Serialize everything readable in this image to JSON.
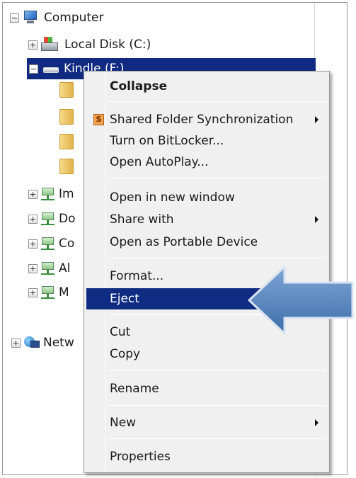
{
  "tree": {
    "computer": "Computer",
    "local_disk": "Local Disk (C:)",
    "kindle": "Kindle (F:)",
    "net_drives": [
      "Im",
      "Do",
      "Co",
      "Al",
      "M"
    ],
    "network": "Netw"
  },
  "menu": {
    "collapse": "Collapse",
    "shared_folder_sync": "Shared Folder Synchronization",
    "shared_folder_sync_icon_letter": "S",
    "bitlocker": "Turn on BitLocker...",
    "autoplay": "Open AutoPlay...",
    "open_new_window": "Open in new window",
    "share_with": "Share with",
    "portable_device": "Open as Portable Device",
    "format": "Format...",
    "eject": "Eject",
    "cut": "Cut",
    "copy": "Copy",
    "rename": "Rename",
    "new": "New",
    "properties": "Properties"
  },
  "colors": {
    "selection": "#0f2a80",
    "pointer_arrow": "#4f81bd"
  }
}
